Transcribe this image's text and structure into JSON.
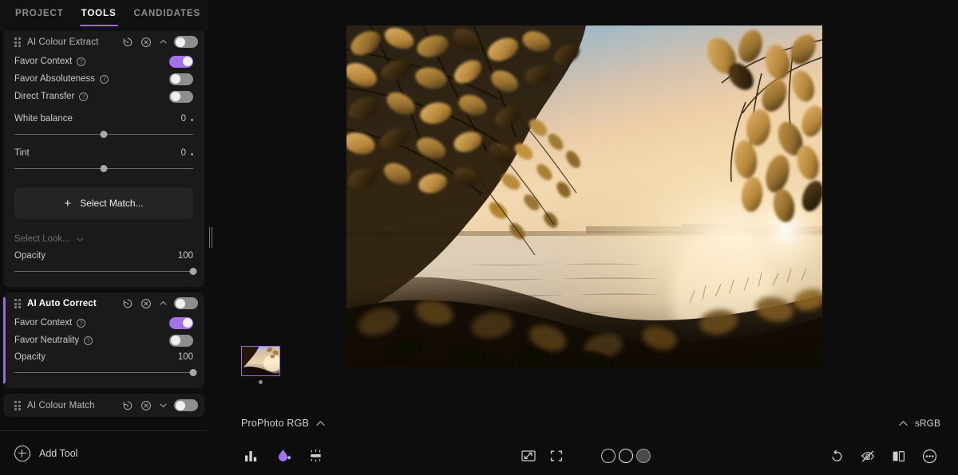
{
  "tabs": [
    {
      "label": "PROJECT",
      "active": false
    },
    {
      "label": "TOOLS",
      "active": true
    },
    {
      "label": "CANDIDATES",
      "active": false
    }
  ],
  "tools": [
    {
      "title": "AI Colour Extract",
      "enabled": false,
      "expanded": true,
      "toggles": [
        {
          "label": "Favor Context",
          "on": true,
          "help": "?"
        },
        {
          "label": "Favor Absoluteness",
          "on": false,
          "help": "?"
        },
        {
          "label": "Direct Transfer",
          "on": false,
          "help": "?"
        }
      ],
      "sliders": [
        {
          "label": "White balance",
          "value": "0",
          "unit": "degree",
          "percent": 50
        },
        {
          "label": "Tint",
          "value": "0",
          "unit": "degree",
          "percent": 50
        }
      ],
      "match_button": "Select Match...",
      "look_select": "Select Look...",
      "opacity": {
        "label": "Opacity",
        "value": "100",
        "percent": 100
      }
    },
    {
      "title": "AI Auto Correct",
      "enabled": false,
      "expanded": true,
      "active_accent": true,
      "toggles": [
        {
          "label": "Favor Context",
          "on": true,
          "help": "?"
        },
        {
          "label": "Favor Neutrality",
          "on": false,
          "help": "?"
        }
      ],
      "opacity": {
        "label": "Opacity",
        "value": "100",
        "percent": 100
      }
    },
    {
      "title": "AI Colour Match",
      "enabled": false,
      "expanded": false
    }
  ],
  "add_tool": {
    "label": "Add Tool",
    "icon": "plus-circle-icon"
  },
  "viewer": {
    "thumbnail_alt": "sunset-lake-thumbnail",
    "color_profile": "ProPhoto RGB",
    "output_profile": "sRGB",
    "left_icons": [
      {
        "name": "histogram-icon",
        "selected": false
      },
      {
        "name": "color-picker-icon",
        "selected": true
      },
      {
        "name": "exposure-icon",
        "selected": false
      }
    ],
    "center_icons": [
      {
        "name": "fit-to-screen-icon"
      },
      {
        "name": "fullscreen-icon"
      }
    ],
    "background_swatches": [
      {
        "name": "background-black",
        "color": "#0b0b0b"
      },
      {
        "name": "background-white",
        "color": "#111111"
      },
      {
        "name": "background-grey",
        "color": "#4a4a4a"
      }
    ],
    "right_icons": [
      {
        "name": "rotate-icon"
      },
      {
        "name": "eye-off-icon"
      },
      {
        "name": "compare-split-icon"
      },
      {
        "name": "more-options-icon"
      }
    ]
  },
  "colors": {
    "accent": "#9a6bdd",
    "toggle_on": "#a273e8",
    "toggle_off": "#8e8e8e",
    "panel_bg": "#1a1a1a",
    "app_bg": "#0d0d0d"
  }
}
